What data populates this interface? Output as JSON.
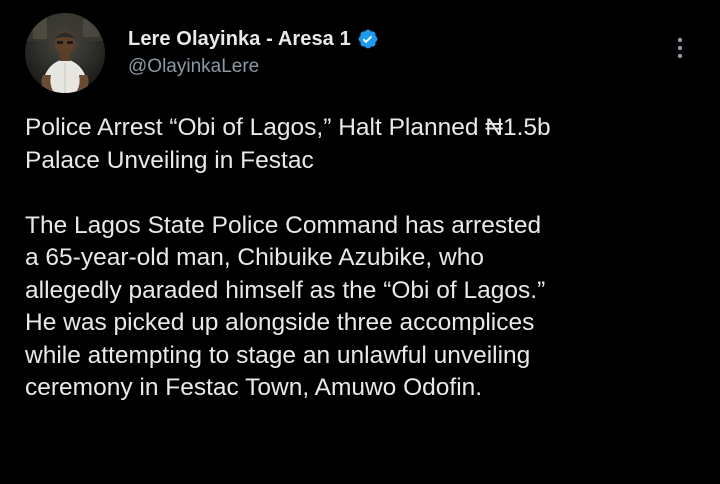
{
  "author": {
    "display_name": "Lere Olayinka - Aresa 1",
    "handle": "@OlayinkaLere",
    "verified_icon": "verified-badge-icon",
    "avatar_icon": "profile-avatar"
  },
  "menu": {
    "more_icon": "more-vertical-icon"
  },
  "tweet": {
    "paragraph_1": "Police Arrest “Obi of Lagos,” Halt Planned ₦1.5b\nPalace Unveiling in Festac",
    "paragraph_2": "The Lagos State Police Command has arrested\na 65-year-old man, Chibuike Azubike, who\nallegedly paraded himself as the “Obi of Lagos.”\nHe was picked up alongside three accomplices\nwhile attempting to stage an unlawful unveiling\nceremony in Festac Town, Amuwo Odofin."
  },
  "colors": {
    "background": "#000000",
    "text_primary": "#e7e9ea",
    "text_secondary": "#8b98a5",
    "verified_blue": "#1d9bf0"
  }
}
